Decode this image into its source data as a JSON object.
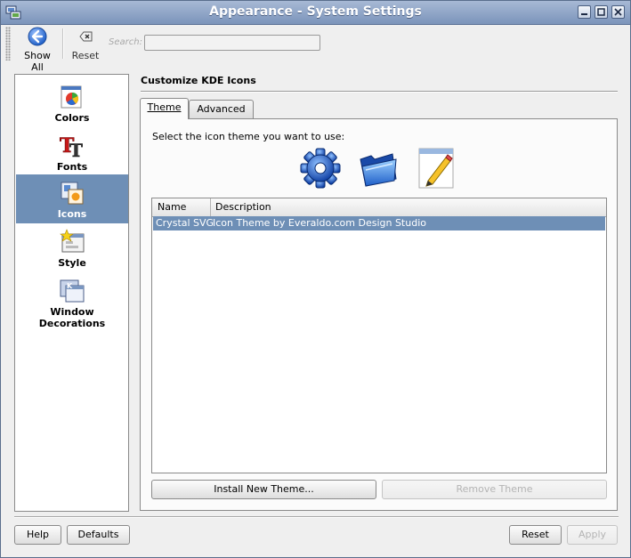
{
  "window": {
    "title": "Appearance - System Settings"
  },
  "toolbar": {
    "show_all_label": "Show All",
    "reset_label": "Reset",
    "search_label": "Search:",
    "search_value": ""
  },
  "sidebar": {
    "items": [
      {
        "label": "Colors",
        "icon": "colors-icon"
      },
      {
        "label": "Fonts",
        "icon": "fonts-icon"
      },
      {
        "label": "Icons",
        "icon": "icons-icon",
        "selected": true
      },
      {
        "label": "Style",
        "icon": "style-icon"
      },
      {
        "label": "Window Decorations",
        "icon": "window-decorations-icon"
      }
    ]
  },
  "main": {
    "heading": "Customize KDE Icons",
    "tabs": [
      {
        "label": "Theme",
        "active": true
      },
      {
        "label": "Advanced",
        "active": false
      }
    ],
    "prompt": "Select the icon theme you want to use:",
    "preview_icons": [
      "gear-icon",
      "folder-icon",
      "document-edit-icon"
    ],
    "table": {
      "columns": [
        "Name",
        "Description"
      ],
      "rows": [
        {
          "name": "Crystal SVG",
          "description": "Icon Theme by Everaldo.com Design Studio",
          "selected": true
        }
      ]
    },
    "install_label": "Install New Theme...",
    "remove_label": "Remove Theme"
  },
  "footer": {
    "help_label": "Help",
    "defaults_label": "Defaults",
    "reset_label": "Reset",
    "apply_label": "Apply"
  },
  "colors": {
    "selection": "#6e8fb6",
    "titlebar": "#8aa0c4"
  }
}
